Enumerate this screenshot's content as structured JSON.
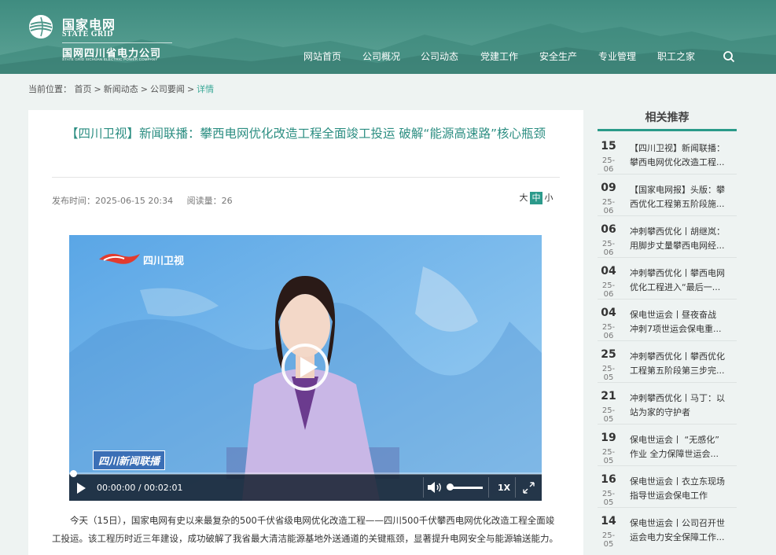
{
  "header": {
    "logo_cn": "国家电网",
    "logo_en": "STATE GRID",
    "company_cn": "国网四川省电力公司",
    "company_en": "STATE GRID SICHUAN ELECTRIC POWER COMPANY",
    "nav": [
      "网站首页",
      "公司概况",
      "公司动态",
      "党建工作",
      "安全生产",
      "专业管理",
      "职工之家"
    ],
    "search_icon": "search-icon"
  },
  "breadcrumb": {
    "prefix": "当前位置：",
    "items": [
      "首页",
      "新闻动态",
      "公司要闻"
    ],
    "current": "详情",
    "sep": ">"
  },
  "article": {
    "title": "【四川卫视】新闻联播：攀西电网优化改造工程全面竣工投运 破解“能源高速路”核心瓶颈",
    "publish_time": "发布时间：2025-06-15 20:34",
    "views": "阅读量：26",
    "font_size": {
      "large": "大",
      "medium": "中",
      "small": "小",
      "selected": "中"
    },
    "body": "今天（15日），国家电网有史以来最复杂的500千伏省级电网优化改造工程——四川500千伏攀西电网优化改造工程全面竣工投运。该工程历时近三年建设，成功破解了我省最大清洁能源基地外送通道的关键瓶颈，显著提升电网安全与能源输送能力。"
  },
  "video": {
    "channel_logo": "四川卫视",
    "program_badge": "四川新闻联播",
    "time": "00:00:00 / 00:02:01",
    "speed": "1X",
    "progress": 0,
    "volume": 1.0,
    "play_icon": "play-icon",
    "volume_icon": "volume-icon",
    "fullscreen_icon": "fullscreen-icon"
  },
  "sidebar": {
    "title": "相关推荐",
    "items": [
      {
        "day": "15",
        "ym": "25-06",
        "line1": "【四川卫视】新闻联播：",
        "line2": "攀西电网优化改造工程..."
      },
      {
        "day": "09",
        "ym": "25-06",
        "line1": "【国家电网报】头版：攀",
        "line2": "西优化工程第五阶段施..."
      },
      {
        "day": "06",
        "ym": "25-06",
        "line1": "冲刺攀西优化丨胡继岚：",
        "line2": "用脚步丈量攀西电网经..."
      },
      {
        "day": "04",
        "ym": "25-06",
        "line1": "冲刺攀西优化丨攀西电网",
        "line2": "优化工程进入“最后一..."
      },
      {
        "day": "04",
        "ym": "25-06",
        "line1": "保电世运会丨昼夜奋战",
        "line2": "冲刺7项世运会保电重..."
      },
      {
        "day": "25",
        "ym": "25-05",
        "line1": "冲刺攀西优化丨攀西优化",
        "line2": "工程第五阶段第三步完..."
      },
      {
        "day": "21",
        "ym": "25-05",
        "line1": "冲刺攀西优化丨马丁：以",
        "line2": "站为家的守护者"
      },
      {
        "day": "19",
        "ym": "25-05",
        "line1": "保电世运会丨 “无感化”",
        "line2": "作业 全力保障世运会..."
      },
      {
        "day": "16",
        "ym": "25-05",
        "line1": "保电世运会丨衣立东现场",
        "line2": "指导世运会保电工作"
      },
      {
        "day": "14",
        "ym": "25-05",
        "line1": "保电世运会丨公司召开世",
        "line2": "运会电力安全保障工作..."
      }
    ]
  },
  "colors": {
    "accent": "#2c9a8b",
    "title": "#2c8e82",
    "header": "#4d978a"
  }
}
